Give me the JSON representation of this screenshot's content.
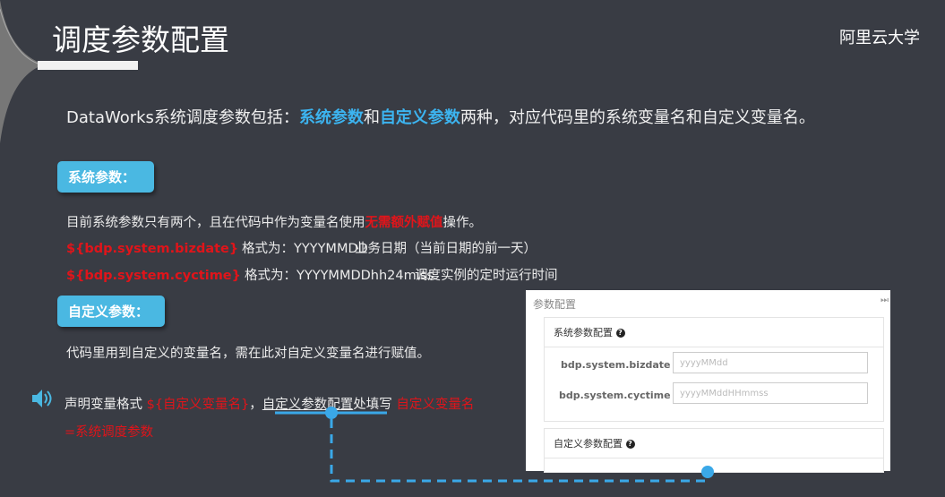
{
  "title": "调度参数配置",
  "brand": "阿里云大学",
  "intro": {
    "prefix": "DataWorks系统调度参数包括：",
    "sys": "系统参数",
    "and": "和",
    "custom": "自定义参数",
    "suffix": "两种，对应代码里的系统变量名和自定义变量名。"
  },
  "sys_section": {
    "badge": "系统参数：",
    "desc_prefix": "目前系统参数只有两个，且在代码中作为变量名使用",
    "desc_highlight": "无需额外赋值",
    "desc_suffix": "操作。",
    "params": [
      {
        "name": "${bdp.system.bizdate}",
        "format": "格式为：YYYYMMDD",
        "meaning": "业务日期（当前日期的前一天）"
      },
      {
        "name": "${bdp.system.cyctime}",
        "format": "格式为：YYYYMMDDhh24miss",
        "meaning": "调度实例的定时运行时间"
      }
    ]
  },
  "custom_section": {
    "badge": "自定义参数：",
    "desc": "代码里用到自定义的变量名，需在此对自定义变量名进行赋值。",
    "note_prefix": "声明变量格式 ",
    "note_var": "${自定义变量名}",
    "note_mid1": "，",
    "note_underlined": "自定义参数配置",
    "note_mid2": "处填写 ",
    "note_red": "自定义变量名",
    "note_red2": "=系统调度参数"
  },
  "panel": {
    "title": "参数配置",
    "sys_header": "系统参数配置",
    "fields": [
      {
        "label": "bdp.system.bizdate",
        "placeholder": "yyyyMMdd"
      },
      {
        "label": "bdp.system.cyctime",
        "placeholder": "yyyyMMddHHmmss"
      }
    ],
    "custom_header": "自定义参数配置",
    "help": "?",
    "collapse": "⏭"
  },
  "colors": {
    "accent": "#4ab8e2",
    "red": "#e0141a",
    "bg": "#393c44",
    "connector": "#3aa8e8"
  }
}
